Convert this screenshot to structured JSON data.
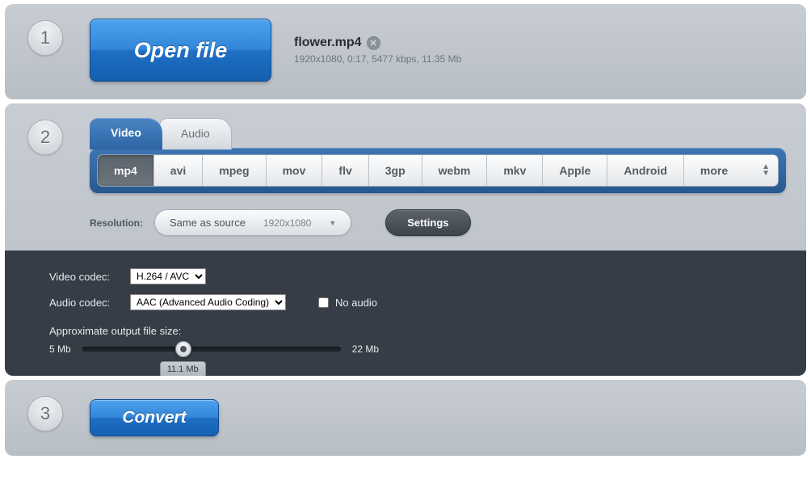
{
  "step1": {
    "num": "1",
    "open_label": "Open file",
    "file_name": "flower.mp4",
    "file_meta": "1920x1080, 0:17, 5477 kbps, 11.35 Mb"
  },
  "step2": {
    "num": "2",
    "tabs": {
      "video": "Video",
      "audio": "Audio"
    },
    "formats": [
      "mp4",
      "avi",
      "mpeg",
      "mov",
      "flv",
      "3gp",
      "webm",
      "mkv",
      "Apple",
      "Android",
      "more"
    ],
    "resolution": {
      "label": "Resolution:",
      "value": "Same as source",
      "dim": "1920x1080"
    },
    "settings_label": "Settings",
    "video_codec_label": "Video codec:",
    "video_codec_value": "H.264 / AVC",
    "audio_codec_label": "Audio codec:",
    "audio_codec_value": "AAC (Advanced Audio Coding)",
    "no_audio_label": "No audio",
    "approx_label": "Approximate output file size:",
    "slider_min": "5 Mb",
    "slider_max": "22 Mb",
    "slider_value": "11.1 Mb"
  },
  "step3": {
    "num": "3",
    "convert_label": "Convert"
  }
}
